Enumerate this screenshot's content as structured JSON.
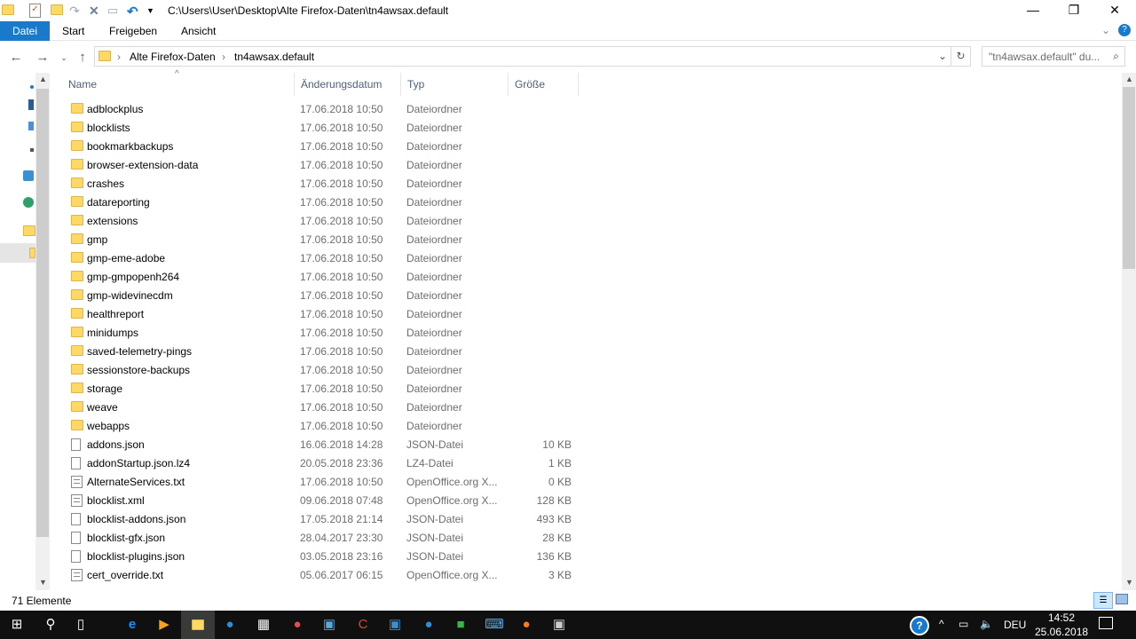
{
  "window": {
    "title": "C:\\Users\\User\\Desktop\\Alte Firefox-Daten\\tn4awsax.default",
    "minimize": "—",
    "maximize": "❐",
    "close": "✕"
  },
  "ribbon": {
    "tabs": [
      "Datei",
      "Start",
      "Freigeben",
      "Ansicht"
    ]
  },
  "address": {
    "crumbs": [
      "Alte Firefox-Daten",
      "tn4awsax.default"
    ],
    "search_placeholder": "\"tn4awsax.default\" du..."
  },
  "columns": {
    "name": "Name",
    "date": "Änderungsdatum",
    "type": "Typ",
    "size": "Größe"
  },
  "files": [
    {
      "name": "adblockplus",
      "date": "17.06.2018 10:50",
      "type": "Dateiordner",
      "size": "",
      "icon": "folder"
    },
    {
      "name": "blocklists",
      "date": "17.06.2018 10:50",
      "type": "Dateiordner",
      "size": "",
      "icon": "folder"
    },
    {
      "name": "bookmarkbackups",
      "date": "17.06.2018 10:50",
      "type": "Dateiordner",
      "size": "",
      "icon": "folder"
    },
    {
      "name": "browser-extension-data",
      "date": "17.06.2018 10:50",
      "type": "Dateiordner",
      "size": "",
      "icon": "folder"
    },
    {
      "name": "crashes",
      "date": "17.06.2018 10:50",
      "type": "Dateiordner",
      "size": "",
      "icon": "folder"
    },
    {
      "name": "datareporting",
      "date": "17.06.2018 10:50",
      "type": "Dateiordner",
      "size": "",
      "icon": "folder"
    },
    {
      "name": "extensions",
      "date": "17.06.2018 10:50",
      "type": "Dateiordner",
      "size": "",
      "icon": "folder"
    },
    {
      "name": "gmp",
      "date": "17.06.2018 10:50",
      "type": "Dateiordner",
      "size": "",
      "icon": "folder"
    },
    {
      "name": "gmp-eme-adobe",
      "date": "17.06.2018 10:50",
      "type": "Dateiordner",
      "size": "",
      "icon": "folder"
    },
    {
      "name": "gmp-gmpopenh264",
      "date": "17.06.2018 10:50",
      "type": "Dateiordner",
      "size": "",
      "icon": "folder"
    },
    {
      "name": "gmp-widevinecdm",
      "date": "17.06.2018 10:50",
      "type": "Dateiordner",
      "size": "",
      "icon": "folder"
    },
    {
      "name": "healthreport",
      "date": "17.06.2018 10:50",
      "type": "Dateiordner",
      "size": "",
      "icon": "folder"
    },
    {
      "name": "minidumps",
      "date": "17.06.2018 10:50",
      "type": "Dateiordner",
      "size": "",
      "icon": "folder"
    },
    {
      "name": "saved-telemetry-pings",
      "date": "17.06.2018 10:50",
      "type": "Dateiordner",
      "size": "",
      "icon": "folder"
    },
    {
      "name": "sessionstore-backups",
      "date": "17.06.2018 10:50",
      "type": "Dateiordner",
      "size": "",
      "icon": "folder"
    },
    {
      "name": "storage",
      "date": "17.06.2018 10:50",
      "type": "Dateiordner",
      "size": "",
      "icon": "folder"
    },
    {
      "name": "weave",
      "date": "17.06.2018 10:50",
      "type": "Dateiordner",
      "size": "",
      "icon": "folder"
    },
    {
      "name": "webapps",
      "date": "17.06.2018 10:50",
      "type": "Dateiordner",
      "size": "",
      "icon": "folder"
    },
    {
      "name": "addons.json",
      "date": "16.06.2018 14:28",
      "type": "JSON-Datei",
      "size": "10 KB",
      "icon": "file"
    },
    {
      "name": "addonStartup.json.lz4",
      "date": "20.05.2018 23:36",
      "type": "LZ4-Datei",
      "size": "1 KB",
      "icon": "file"
    },
    {
      "name": "AlternateServices.txt",
      "date": "17.06.2018 10:50",
      "type": "OpenOffice.org X...",
      "size": "0 KB",
      "icon": "txt"
    },
    {
      "name": "blocklist.xml",
      "date": "09.06.2018 07:48",
      "type": "OpenOffice.org X...",
      "size": "128 KB",
      "icon": "txt"
    },
    {
      "name": "blocklist-addons.json",
      "date": "17.05.2018 21:14",
      "type": "JSON-Datei",
      "size": "493 KB",
      "icon": "file"
    },
    {
      "name": "blocklist-gfx.json",
      "date": "28.04.2017 23:30",
      "type": "JSON-Datei",
      "size": "28 KB",
      "icon": "file"
    },
    {
      "name": "blocklist-plugins.json",
      "date": "03.05.2018 23:16",
      "type": "JSON-Datei",
      "size": "136 KB",
      "icon": "file"
    },
    {
      "name": "cert_override.txt",
      "date": "05.06.2017 06:15",
      "type": "OpenOffice.org X...",
      "size": "3 KB",
      "icon": "txt"
    }
  ],
  "status": {
    "count": "71 Elemente"
  },
  "taskbar": {
    "language": "DEU",
    "time": "14:52",
    "date": "25.06.2018"
  }
}
